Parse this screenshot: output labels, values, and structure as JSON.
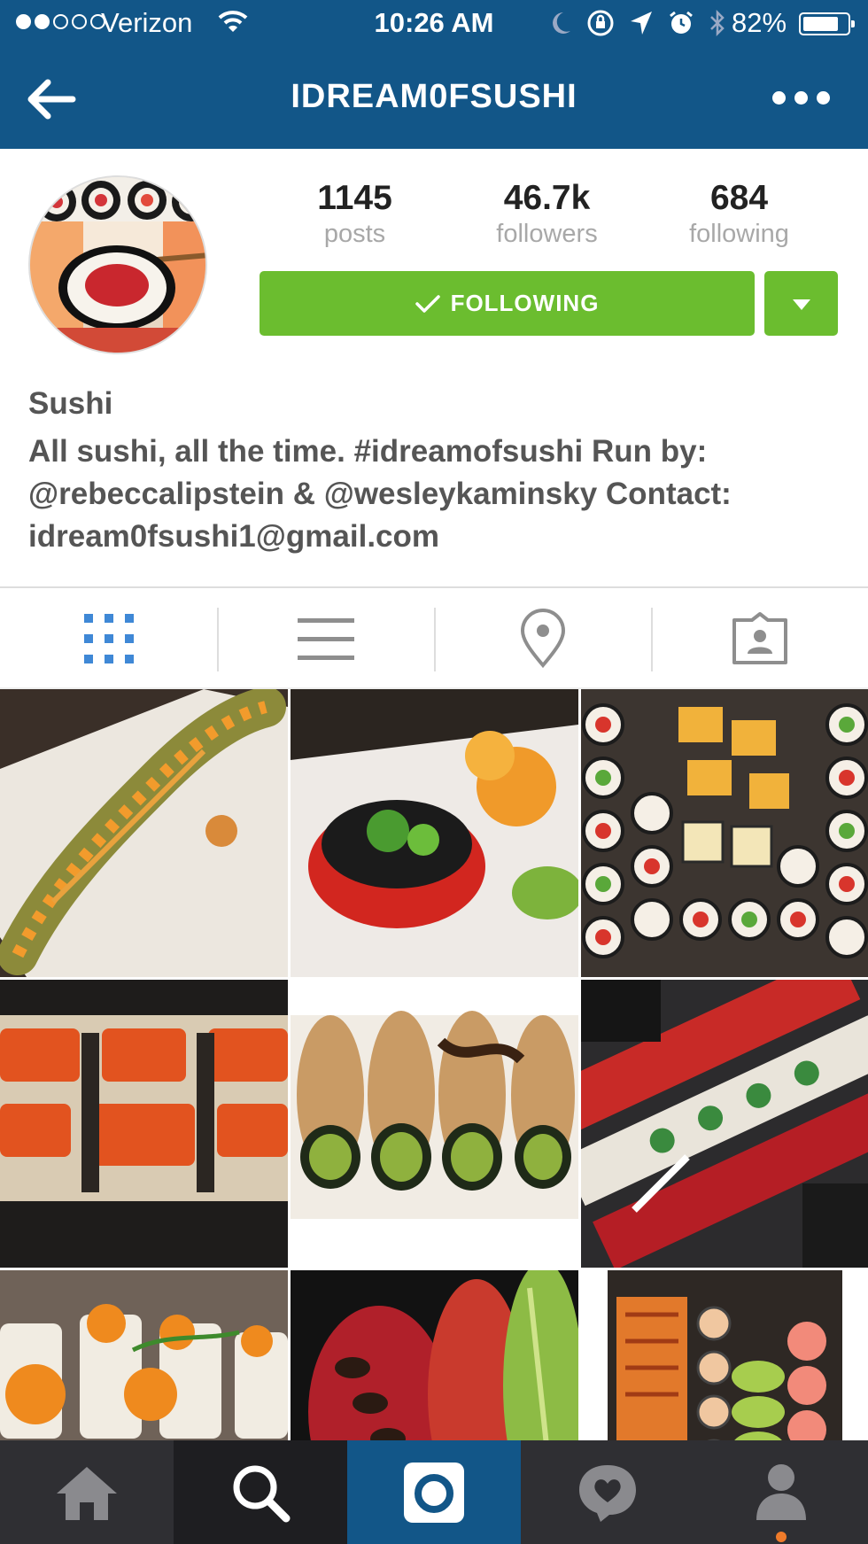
{
  "status_bar": {
    "carrier": "Verizon",
    "time": "10:26 AM",
    "battery": "82%",
    "battery_level": 0.82,
    "signal_bars_full": 2,
    "signal_bars_total": 5
  },
  "nav": {
    "title": "IDREAM0FSUSHI",
    "back_icon": "arrow-left-icon",
    "more_icon": "more-dots-icon"
  },
  "profile": {
    "stats": [
      {
        "value": "1145",
        "label": "posts"
      },
      {
        "value": "46.7k",
        "label": "followers"
      },
      {
        "value": "684",
        "label": "following"
      }
    ],
    "follow_button": "FOLLOWING",
    "name": "Sushi",
    "bio": "All sushi, all the time. #idreamofsushi Run by: @rebeccalipstein & @wesleykaminsky Contact: idream0fsushi1@gmail.com"
  },
  "view_tabs": [
    {
      "icon": "grid-icon",
      "active": true
    },
    {
      "icon": "list-icon",
      "active": false
    },
    {
      "icon": "location-pin-icon",
      "active": false
    },
    {
      "icon": "tagged-photos-icon",
      "active": false
    }
  ],
  "bottom_tabs": [
    {
      "icon": "home-icon"
    },
    {
      "icon": "search-icon"
    },
    {
      "icon": "camera-icon"
    },
    {
      "icon": "activity-heart-icon"
    },
    {
      "icon": "profile-icon"
    }
  ],
  "colors": {
    "brand_blue": "#125688",
    "follow_green": "#6bbd2f",
    "tab_active": "#3f88d6",
    "notification_dot": "#f07b2a"
  }
}
